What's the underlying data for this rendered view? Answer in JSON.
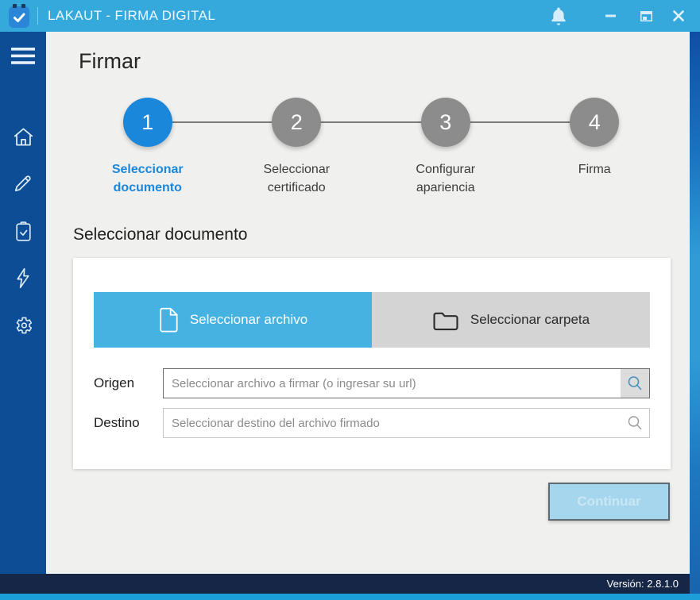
{
  "titlebar": {
    "title": "LAKAUT - FIRMA DIGITAL"
  },
  "page": {
    "title": "Firmar"
  },
  "stepper": {
    "steps": [
      {
        "number": "1",
        "label": "Seleccionar documento",
        "active": true
      },
      {
        "number": "2",
        "label": "Seleccionar certificado",
        "active": false
      },
      {
        "number": "3",
        "label": "Configurar apariencia",
        "active": false
      },
      {
        "number": "4",
        "label": "Firma",
        "active": false
      }
    ]
  },
  "section": {
    "title": "Seleccionar documento"
  },
  "tabs": [
    {
      "label": "Seleccionar archivo",
      "icon": "file-icon",
      "active": true
    },
    {
      "label": "Seleccionar carpeta",
      "icon": "folder-icon",
      "active": false
    }
  ],
  "form": {
    "origen": {
      "label": "Origen",
      "value": "",
      "placeholder": "Seleccionar archivo a firmar (o ingresar su url)"
    },
    "destino": {
      "label": "Destino",
      "value": "",
      "placeholder": "Seleccionar destino del archivo firmado"
    }
  },
  "actions": {
    "continue_label": "Continuar",
    "continue_enabled": false
  },
  "statusbar": {
    "version": "Versión: 2.8.1.0"
  },
  "icons": [
    "app-logo-icon",
    "bell-icon",
    "minimize-icon",
    "maximize-icon",
    "close-icon",
    "menu-icon",
    "home-icon",
    "pencil-icon",
    "clipboard-check-icon",
    "lightning-icon",
    "gear-icon",
    "file-icon",
    "folder-icon",
    "search-icon"
  ],
  "colors": {
    "titlebar": "#36a9dc",
    "sidebar": "#0c4d95",
    "accent": "#1b87db",
    "tab_active": "#45b2e2",
    "tab_inactive": "#d4d4d4",
    "statusbar": "#152647",
    "bottom_strip": "#1c9fd9",
    "disabled_button_bg": "#a6d6ed",
    "step_inactive": "#8c8c8c",
    "main_bg": "#f0f0ee"
  }
}
